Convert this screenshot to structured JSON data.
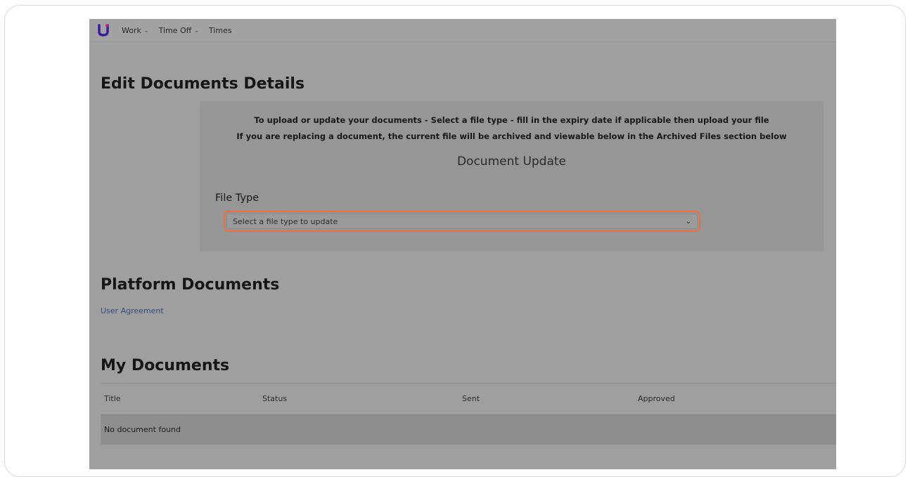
{
  "nav": {
    "logo": "U",
    "items": [
      {
        "label": "Work",
        "has_dropdown": true
      },
      {
        "label": "Time Off",
        "has_dropdown": true
      },
      {
        "label": "Times",
        "has_dropdown": false
      }
    ]
  },
  "page": {
    "title": "Edit Documents Details"
  },
  "upload": {
    "instruction_1": "To upload or update your documents - Select a file type - fill in the expiry date if applicable then upload your file",
    "instruction_2": "If you are replacing a document, the current file will be archived and viewable below in the Archived Files section below",
    "heading": "Document Update",
    "file_type_label": "File Type",
    "file_type_select": {
      "selected": "Select a file type to update"
    }
  },
  "platform_documents": {
    "title": "Platform Documents",
    "links": [
      "User Agreement"
    ]
  },
  "my_documents": {
    "title": "My Documents",
    "columns": [
      "Title",
      "Status",
      "Sent",
      "Approved"
    ],
    "empty_message": "No document found"
  },
  "colors": {
    "highlight": "#f26d3d",
    "link": "#354a7c",
    "logo_primary": "#3a1a9a",
    "logo_accent": "#c21e7a"
  }
}
